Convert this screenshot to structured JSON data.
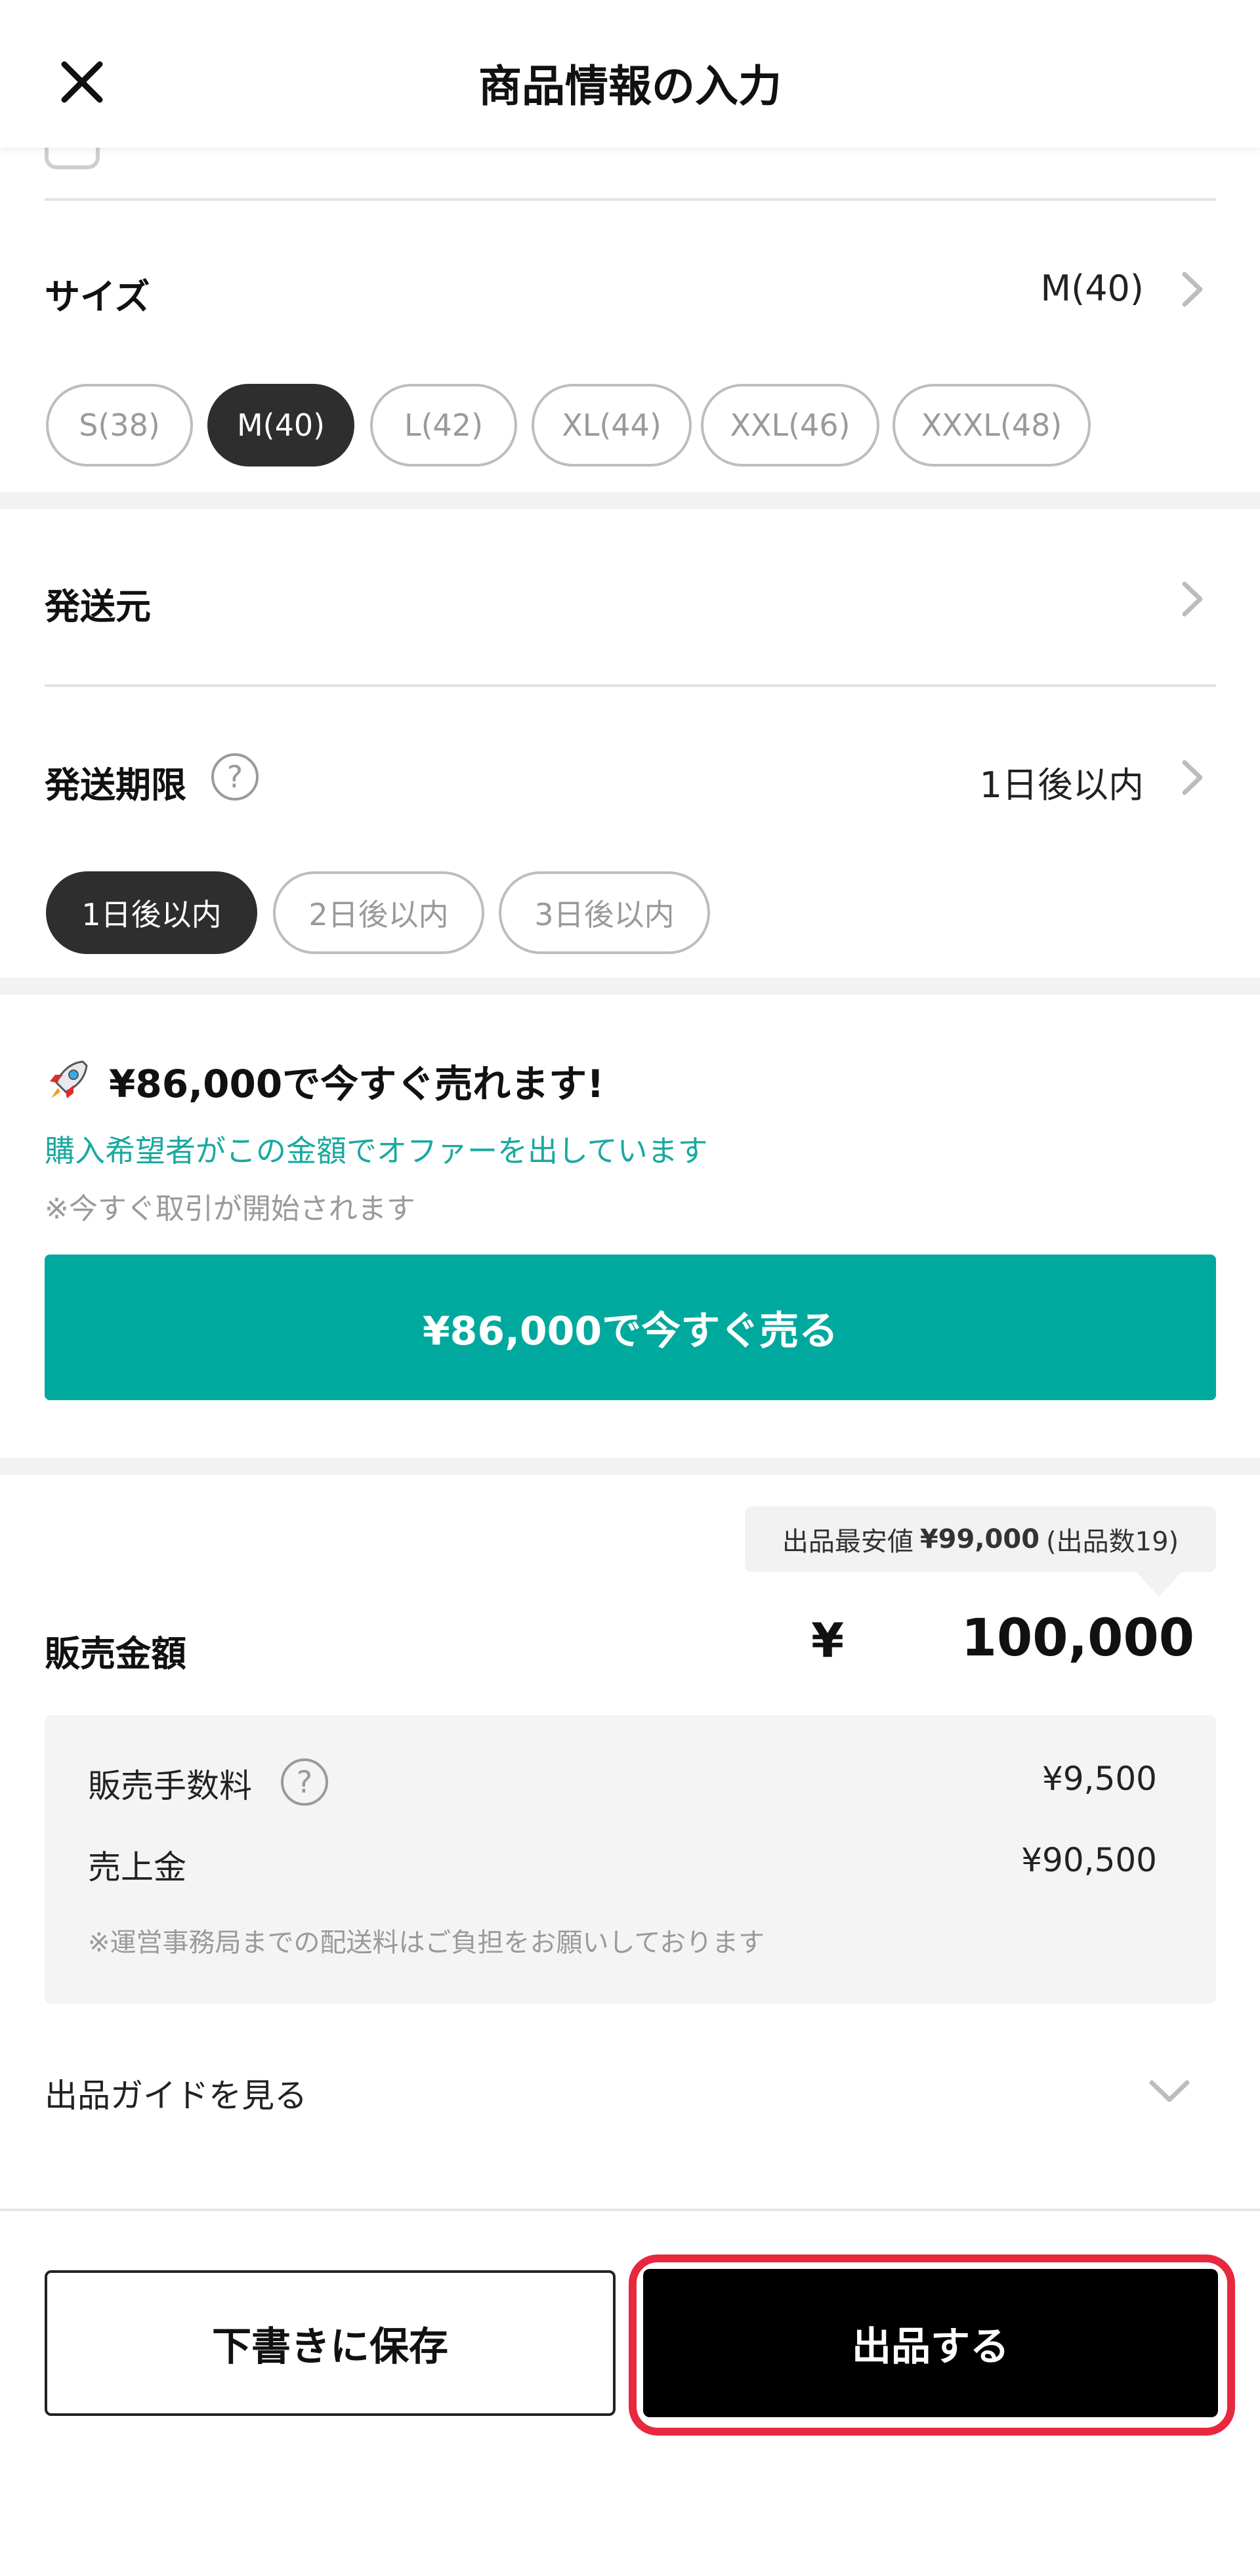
{
  "header": {
    "title": "商品情報の入力",
    "close_icon": "close-icon"
  },
  "size": {
    "label": "サイズ",
    "value": "M(40)",
    "options": [
      "S(38)",
      "M(40)",
      "L(42)",
      "XL(44)",
      "XXL(46)",
      "XXXL(48)"
    ],
    "selected": "M(40)"
  },
  "ship_from": {
    "label": "発送元"
  },
  "ship_deadline": {
    "label": "発送期限",
    "help": "?",
    "value": "1日後以内",
    "options": [
      "1日後以内",
      "2日後以内",
      "3日後以内"
    ],
    "selected": "1日後以内"
  },
  "offer": {
    "icon": "rocket-icon",
    "title": "¥86,000で今すぐ売れます!",
    "subtitle": "購入希望者がこの金額でオファーを出しています",
    "note": "※今すぐ取引が開始されます",
    "button_label": "¥86,000で今すぐ売る"
  },
  "pricing": {
    "tooltip_prefix": "出品最安値",
    "tooltip_price": "¥99,000",
    "tooltip_suffix": "(出品数19)",
    "label": "販売金額",
    "currency": "¥",
    "value": "100,000",
    "fee_label": "販売手数料",
    "fee_help": "?",
    "fee_value": "¥9,500",
    "proceeds_label": "売上金",
    "proceeds_value": "¥90,500",
    "shipping_note": "※運営事務局までの配送料はご負担をお願いしております"
  },
  "guide": {
    "label": "出品ガイドを見る"
  },
  "footer": {
    "draft_label": "下書きに保存",
    "submit_label": "出品する"
  },
  "colors": {
    "accent": "#00a99e",
    "highlight": "#e8283f",
    "selected_pill": "#2e2e2e"
  }
}
